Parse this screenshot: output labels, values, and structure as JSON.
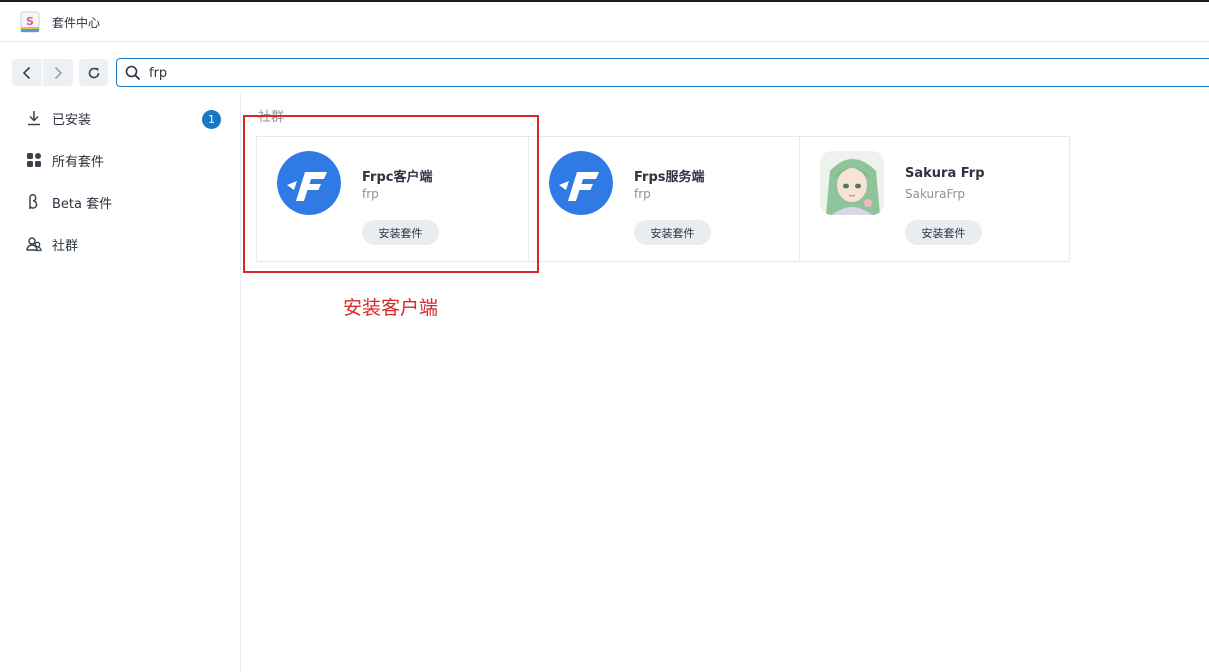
{
  "window": {
    "title": "套件中心"
  },
  "toolbar": {
    "search_value": "frp",
    "back_icon": "chevron-left-icon",
    "forward_icon": "chevron-right-icon",
    "refresh_icon": "refresh-icon",
    "search_icon": "search-icon"
  },
  "sidebar": {
    "items": [
      {
        "label": "已安装",
        "icon": "download-icon",
        "badge": "1"
      },
      {
        "label": "所有套件",
        "icon": "grid-icon"
      },
      {
        "label": "Beta 套件",
        "icon": "beta-icon"
      },
      {
        "label": "社群",
        "icon": "community-icon"
      }
    ]
  },
  "main": {
    "section_label": "社群",
    "packages": [
      {
        "name": "Frpc客户端",
        "sub": "frp",
        "button": "安装套件",
        "icon": "frp-logo-icon"
      },
      {
        "name": "Frps服务端",
        "sub": "frp",
        "button": "安装套件",
        "icon": "frp-logo-icon"
      },
      {
        "name": "Sakura Frp",
        "sub": "SakuraFrp",
        "button": "安装套件",
        "icon": "sakura-avatar-icon"
      }
    ]
  },
  "annotation": {
    "text": "安装客户端",
    "color": "#d8282c"
  },
  "colors": {
    "accent": "#1a78c2",
    "frp_blue": "#2f7ae5"
  }
}
